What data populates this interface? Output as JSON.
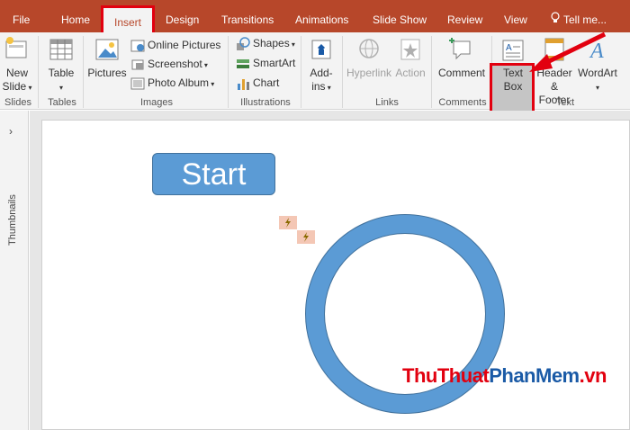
{
  "tabs": {
    "file": "File",
    "home": "Home",
    "insert": "Insert",
    "design": "Design",
    "transitions": "Transitions",
    "animations": "Animations",
    "slideshow": "Slide Show",
    "review": "Review",
    "view": "View",
    "tell": "Tell me..."
  },
  "ribbon": {
    "slides": {
      "new_slide": "New",
      "new_slide2": "Slide",
      "label": "Slides"
    },
    "tables": {
      "table": "Table",
      "label": "Tables"
    },
    "images": {
      "pictures": "Pictures",
      "online_pictures": "Online Pictures",
      "screenshot": "Screenshot",
      "photo_album": "Photo Album",
      "label": "Images"
    },
    "illustrations": {
      "shapes": "Shapes",
      "smartart": "SmartArt",
      "chart": "Chart",
      "label": "Illustrations"
    },
    "addins": {
      "addins1": "Add-",
      "addins2": "ins"
    },
    "links": {
      "hyperlink": "Hyperlink",
      "action": "Action",
      "label": "Links"
    },
    "comments": {
      "comment": "Comment",
      "label": "Comments"
    },
    "text": {
      "textbox1": "Text",
      "textbox2": "Box",
      "header1": "Header",
      "header2": "& Footer",
      "wordart": "WordArt",
      "label": "Text"
    }
  },
  "thumbnails_label": "Thumbnails",
  "slide": {
    "start_text": "Start"
  },
  "watermark": {
    "part1": "ThuThuat",
    "part2": "PhanMem",
    "part3": ".vn"
  },
  "colors": {
    "accent": "#b7472a",
    "shape_fill": "#5b9bd5",
    "highlight": "#e2000f"
  }
}
